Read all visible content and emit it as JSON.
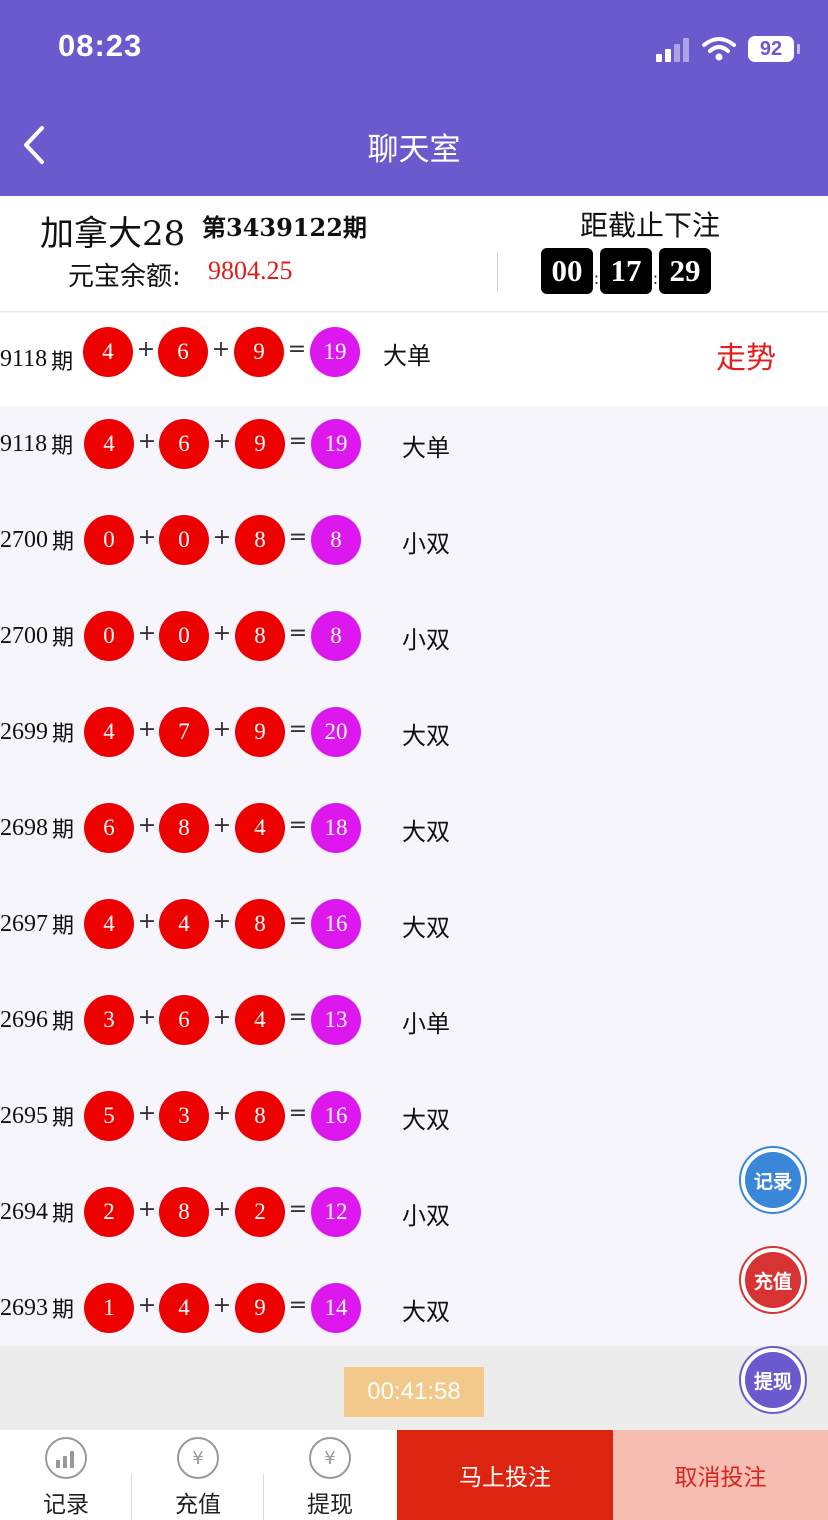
{
  "status_bar": {
    "time": "08:23",
    "battery": "92"
  },
  "header": {
    "title": "聊天室",
    "back_icon": "chevron-left-icon"
  },
  "info": {
    "game_name": "加拿大28",
    "period": "第3439122期",
    "balance_label": "元宝余额:",
    "balance_value": "9804.25",
    "deadline_label": "距截止下注",
    "countdown": [
      "00",
      "17",
      "29"
    ]
  },
  "trend_link": "走势",
  "latest": {
    "issue": "9118",
    "balls": [
      "4",
      "6",
      "9"
    ],
    "sum": "19",
    "result": "大单"
  },
  "history": [
    {
      "issue": "9118",
      "balls": [
        "4",
        "6",
        "9"
      ],
      "sum": "19",
      "result": "大单"
    },
    {
      "issue": "2700",
      "balls": [
        "0",
        "0",
        "8"
      ],
      "sum": "8",
      "result": "小双"
    },
    {
      "issue": "2700",
      "balls": [
        "0",
        "0",
        "8"
      ],
      "sum": "8",
      "result": "小双"
    },
    {
      "issue": "2699",
      "balls": [
        "4",
        "7",
        "9"
      ],
      "sum": "20",
      "result": "大双"
    },
    {
      "issue": "2698",
      "balls": [
        "6",
        "8",
        "4"
      ],
      "sum": "18",
      "result": "大双"
    },
    {
      "issue": "2697",
      "balls": [
        "4",
        "4",
        "8"
      ],
      "sum": "16",
      "result": "大双"
    },
    {
      "issue": "2696",
      "balls": [
        "3",
        "6",
        "4"
      ],
      "sum": "13",
      "result": "小单"
    },
    {
      "issue": "2695",
      "balls": [
        "5",
        "3",
        "8"
      ],
      "sum": "16",
      "result": "大双"
    },
    {
      "issue": "2694",
      "balls": [
        "2",
        "8",
        "2"
      ],
      "sum": "12",
      "result": "小双"
    },
    {
      "issue": "2693",
      "balls": [
        "1",
        "4",
        "9"
      ],
      "sum": "14",
      "result": "大双"
    }
  ],
  "issue_suffix": "期",
  "operators": {
    "plus": "+",
    "equals": "="
  },
  "timer": "00:41:58",
  "floating_buttons": {
    "records": "记录",
    "recharge": "充值",
    "withdraw": "提现"
  },
  "bottom_nav": {
    "records": "记录",
    "recharge": "充值",
    "withdraw": "提现",
    "bet_now": "马上投注",
    "cancel_bet": "取消投注"
  },
  "colors": {
    "brand": "#6a5acd",
    "ball_red": "#ec0000",
    "ball_sum": "#dd18ee",
    "bet_button": "#dc2410"
  }
}
